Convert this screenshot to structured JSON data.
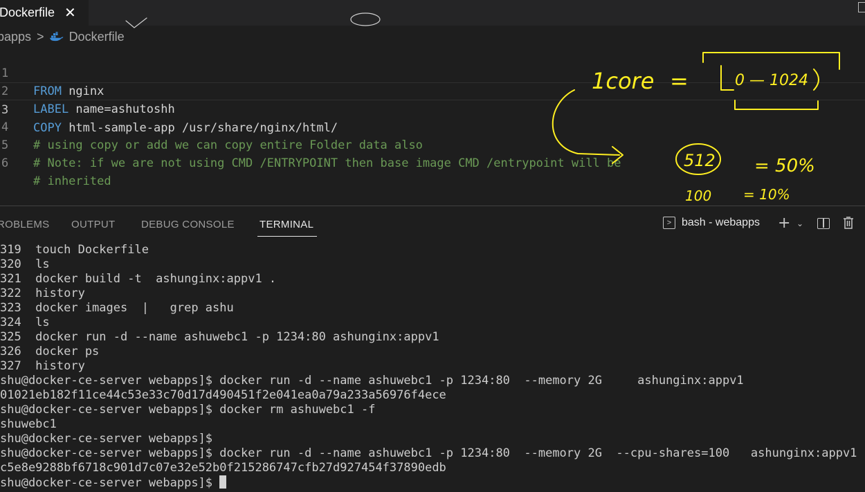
{
  "tab": {
    "label": "Dockerfile",
    "close_glyph": "✕"
  },
  "breadcrumb": {
    "root": "bapps",
    "separator": ">",
    "file": "Dockerfile",
    "file_icon": "docker-whale-icon"
  },
  "editor": {
    "lines": [
      {
        "num": "1",
        "keyword": "FROM",
        "rest": " nginx"
      },
      {
        "num": "2",
        "keyword": "LABEL",
        "rest": " name=ashutoshh"
      },
      {
        "num": "3",
        "keyword": "COPY",
        "rest": " html-sample-app /usr/share/nginx/html/"
      },
      {
        "num": "4",
        "comment": "# using copy or add we can copy entire Folder data also"
      },
      {
        "num": "5",
        "comment": "# Note: if we are not using CMD /ENTRYPOINT then base image CMD /entrypoint will be"
      },
      {
        "num": "6",
        "comment": "# inherited"
      }
    ]
  },
  "panel": {
    "tabs": [
      "ROBLEMS",
      "OUTPUT",
      "DEBUG CONSOLE",
      "TERMINAL"
    ],
    "active_tab": "TERMINAL",
    "terminal_select": "bash - webapps",
    "icons": [
      "terminal-icon",
      "plus-icon",
      "chevron-down-icon",
      "split-icon",
      "trash-icon"
    ]
  },
  "terminal": {
    "lines": [
      "319  touch Dockerfile",
      "320  ls",
      "321  docker build -t  ashunginx:appv1 .",
      "322  history",
      "323  docker images  |   grep ashu",
      "324  ls",
      "325  docker run -d --name ashuwebc1 -p 1234:80 ashunginx:appv1",
      "326  docker ps",
      "327  history",
      "shu@docker-ce-server webapps]$ docker run -d --name ashuwebc1 -p 1234:80  --memory 2G     ashunginx:appv1",
      "01021eb182f11ce44c53e33c70d17d490451f2e041ea0a79a233a56976f4ece",
      "shu@docker-ce-server webapps]$ docker rm ashuwebc1 -f",
      "shuwebc1",
      "shu@docker-ce-server webapps]$",
      "shu@docker-ce-server webapps]$ docker run -d --name ashuwebc1 -p 1234:80  --memory 2G  --cpu-shares=100   ashunginx:appv1",
      "c5e8e9288bf6718c901d7c07e32e52b0f215286747cfb27d927454f37890edb"
    ],
    "prompt": "shu@docker-ce-server webapps]$ "
  },
  "annotations": {
    "core": "1core",
    "equals": "=",
    "range": "0 — 1024",
    "a512": "512",
    "p50": "= 50%",
    "a100": "100",
    "p10": "= 10%"
  },
  "colors": {
    "keyword": "#569cd6",
    "comment": "#6a9955",
    "annotation": "#ffef21",
    "background": "#1e1e1e"
  }
}
